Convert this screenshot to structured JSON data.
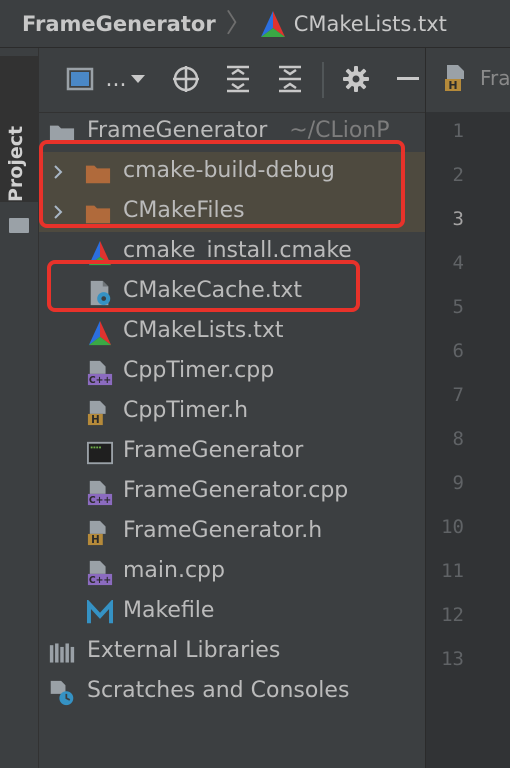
{
  "breadcrumb": {
    "root": "FrameGenerator",
    "file": "CMakeLists.txt"
  },
  "sidebar": {
    "project_label": "Project"
  },
  "toolbar": {
    "view_label": "...",
    "icons": [
      "view-mode-icon",
      "chevron-down-icon",
      "locate-icon",
      "expand-all-icon",
      "collapse-all-icon",
      "gear-icon",
      "minimize-icon"
    ]
  },
  "editor": {
    "tab_label": "Fra",
    "line_numbers": [
      "1",
      "2",
      "3",
      "4",
      "5",
      "6",
      "7",
      "8",
      "9",
      "10",
      "11",
      "12",
      "13"
    ],
    "current_line": "3"
  },
  "tree": {
    "root": {
      "label": "FrameGenerator",
      "path": "~/CLionP"
    },
    "items": [
      {
        "label": "cmake-build-debug",
        "type": "folder",
        "expandable": true
      },
      {
        "label": "CMakeFiles",
        "type": "folder",
        "expandable": true
      },
      {
        "label": "cmake_install.cmake",
        "type": "cmake"
      },
      {
        "label": "CMakeCache.txt",
        "type": "cmake-cache"
      },
      {
        "label": "CMakeLists.txt",
        "type": "cmake"
      },
      {
        "label": "CppTimer.cpp",
        "type": "cpp"
      },
      {
        "label": "CppTimer.h",
        "type": "h"
      },
      {
        "label": "FrameGenerator",
        "type": "exec"
      },
      {
        "label": "FrameGenerator.cpp",
        "type": "cpp"
      },
      {
        "label": "FrameGenerator.h",
        "type": "h"
      },
      {
        "label": "main.cpp",
        "type": "cpp"
      },
      {
        "label": "Makefile",
        "type": "makefile"
      }
    ],
    "external": "External Libraries",
    "scratches": "Scratches and Consoles"
  },
  "colors": {
    "highlight": "#e8322a",
    "folder": "#b06a3b",
    "cpp_badge": "#8b6bbf",
    "h_badge": "#b58a3a"
  }
}
